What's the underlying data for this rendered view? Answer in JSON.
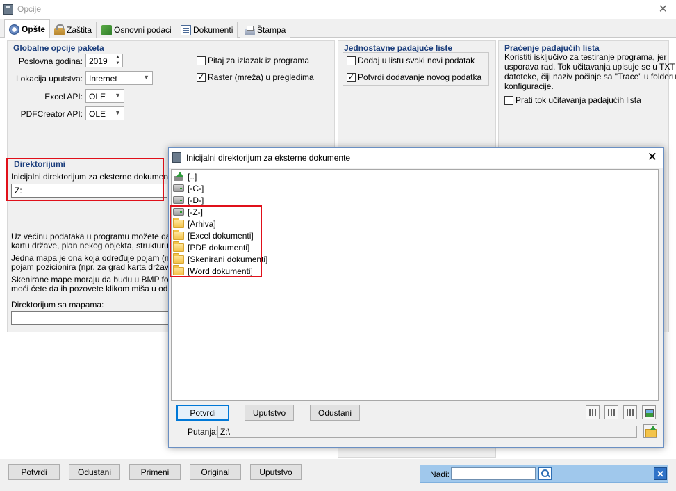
{
  "window": {
    "title": "Opcije",
    "close_glyph": "✕"
  },
  "tabs": [
    {
      "label": "Opšte",
      "icon": "gear-icon",
      "active": true
    },
    {
      "label": "Zaštita",
      "icon": "lock-icon"
    },
    {
      "label": "Osnovni podaci",
      "icon": "package-icon"
    },
    {
      "label": "Dokumenti",
      "icon": "document-icon"
    },
    {
      "label": "Štampa",
      "icon": "printer-icon"
    }
  ],
  "global": {
    "title": "Globalne opcije paketa",
    "year_label": "Poslovna godina:",
    "year_value": "2019",
    "help_location_label": "Lokacija uputstva:",
    "help_location_value": "Internet",
    "excel_api_label": "Excel API:",
    "excel_api_value": "OLE",
    "pdf_api_label": "PDFCreator API:",
    "pdf_api_value": "OLE",
    "ask_exit_label": "Pitaj za izlazak iz programa",
    "ask_exit_checked": false,
    "raster_label": "Raster (mreža) u pregledima",
    "raster_checked": true
  },
  "simple_lists": {
    "title": "Jednostavne padajuće liste",
    "add_new_label": "Dodaj u listu svaki novi podatak",
    "add_new_checked": false,
    "confirm_label": "Potvrdi dodavanje novog podatka",
    "confirm_checked": true
  },
  "tracking": {
    "title": "Praćenje padajućih lista",
    "desc_1": "Koristiti isključivo za testiranje programa, jer",
    "desc_2": "usporava rad. Tok učitavanja upisuje se u TXT",
    "desc_3": "datoteke, čiji naziv počinje sa \"Trace\" u folderu",
    "desc_4": "konfiguracije.",
    "track_label": "Prati tok učitavanja padajućih lista",
    "track_checked": false
  },
  "directories": {
    "title": "Direktorijumi",
    "initial_dir_label": "Inicijalni direktorijum za eksterne dokumente:",
    "initial_dir_value": "Z:",
    "maps_p1_l1": "Uz većinu podataka u programu možete da veže",
    "maps_p1_l2": "kartu države, plan nekog objekta, strukturu pro",
    "maps_p2_l1": "Jedna mapa je ona koja određuje pojam (npr. z",
    "maps_p2_l2": "pojam pozicionira (npr. za grad karta države)",
    "maps_p3_l1": "Skenirane mape moraju da budu u BMP formatu",
    "maps_p3_l2": "moći ćete da ih pozovete klikom miša u odgovar",
    "maps_dir_label": "Direktorijum sa mapama:",
    "maps_dir_value": ""
  },
  "bottom_buttons": {
    "confirm": "Potvrdi",
    "cancel": "Odustani",
    "apply": "Primeni",
    "original": "Original",
    "help": "Uputstvo"
  },
  "find": {
    "label": "Nađi:",
    "value": "",
    "close_glyph": "✕"
  },
  "dialog": {
    "title": "Inicijalni direktorijum za eksterne dokumente",
    "close_glyph": "✕",
    "items": [
      {
        "label": "[..]",
        "icon": "up-folder-icon"
      },
      {
        "label": "[-C-]",
        "icon": "drive-icon"
      },
      {
        "label": "[-D-]",
        "icon": "drive-icon"
      },
      {
        "label": "[-Z-]",
        "icon": "drive-icon"
      },
      {
        "label": "[Arhiva]",
        "icon": "folder-icon"
      },
      {
        "label": "[Excel dokumenti]",
        "icon": "folder-icon"
      },
      {
        "label": "[PDF dokumenti]",
        "icon": "folder-icon"
      },
      {
        "label": "[Skenirani dokumenti]",
        "icon": "folder-icon"
      },
      {
        "label": "[Word dokumenti]",
        "icon": "folder-icon"
      }
    ],
    "confirm": "Potvrdi",
    "help": "Uputstvo",
    "cancel": "Odustani",
    "path_label": "Putanja:",
    "path_value": "Z:\\"
  },
  "colors": {
    "accent": "#0078d7",
    "group_title": "#1a3d7c",
    "highlight": "#e0101a",
    "find_bar": "#a0c8ec"
  }
}
